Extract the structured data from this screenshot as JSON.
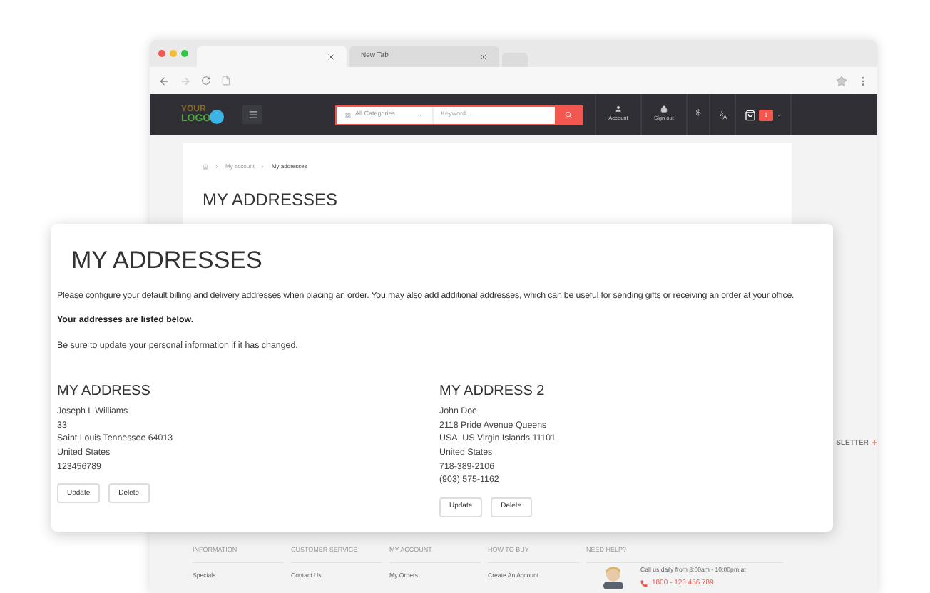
{
  "browser": {
    "tabs": [
      {
        "selected": true
      },
      {
        "label": "New Tab",
        "selected": false
      }
    ]
  },
  "header": {
    "logo": [
      "YOUR",
      "LOGO"
    ],
    "search": {
      "category": "All Categories",
      "placeholder": "Keyword..."
    },
    "nav": [
      {
        "label": "Account",
        "kind": "user"
      },
      {
        "label": "Sign out",
        "kind": "lock"
      }
    ],
    "currency": "$",
    "cart_count": "1"
  },
  "breadcrumb": [
    "My account",
    "My addresses"
  ],
  "page_title": "MY ADDRESSES",
  "side_text": {
    "label": "SLETTER",
    "action": "+"
  },
  "footer": {
    "columns": [
      {
        "heading": "INFORMATION",
        "link": "Specials"
      },
      {
        "heading": "CUSTOMER SERVICE",
        "link": "Contact Us"
      },
      {
        "heading": "MY ACCOUNT",
        "link": "My Orders"
      },
      {
        "heading": "HOW TO BUY",
        "link": "Create An Account"
      }
    ],
    "help": {
      "heading": "NEED HELP?",
      "text": "Call us daily from 8:00am - 10:00pm at",
      "phone": "1800 - 123 456 789"
    }
  },
  "overlay": {
    "title": "MY ADDRESSES",
    "intro": "Please configure your default billing and delivery addresses when placing an order. You may also add additional addresses, which can be useful for sending gifts or receiving an order at your office.",
    "listed": "Your addresses are listed below.",
    "note": "Be sure to update your personal information if it has changed.",
    "addresses": [
      {
        "title": "MY ADDRESS",
        "lines": [
          "Joseph L Williams",
          "33",
          "Saint Louis Tennessee 64013",
          "United States",
          "123456789"
        ],
        "buttons": [
          "Update",
          "Delete"
        ]
      },
      {
        "title": "MY ADDRESS 2",
        "lines": [
          "John Doe",
          "2118 Pride Avenue Queens",
          "USA, US Virgin Islands 11101",
          "United States",
          "718-389-2106",
          "(903) 575-1162"
        ],
        "buttons": [
          "Update",
          "Delete"
        ]
      }
    ]
  }
}
